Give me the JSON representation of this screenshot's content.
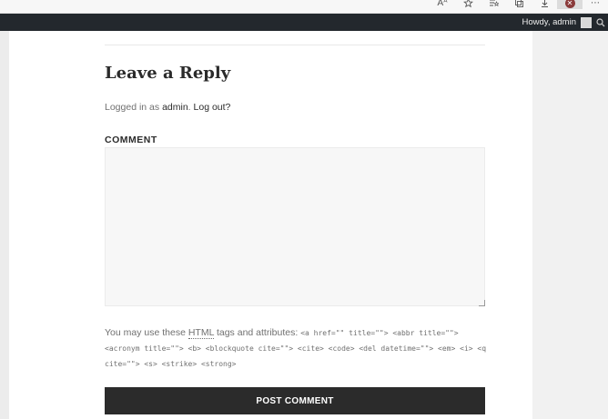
{
  "browser": {
    "icons": [
      "read-aloud-icon",
      "favorites-add-icon",
      "favorites-icon",
      "collections-icon",
      "downloads-icon",
      "profile-icon",
      "more-icon"
    ],
    "read_aloud_glyph": "Aᴬ",
    "profile_glyph": "✕",
    "more_glyph": "⋯"
  },
  "admin_bar": {
    "greeting": "Howdy, admin"
  },
  "reply": {
    "title": "Leave a Reply",
    "logged_in_prefix": "Logged in as ",
    "user_link": "admin",
    "separator": ". ",
    "logout_link": "Log out?",
    "comment_label": "COMMENT",
    "comment_value": "",
    "allowed_prefix": "You may use these ",
    "allowed_abbr": "HTML",
    "allowed_suffix": " tags and attributes: ",
    "allowed_tags": "<a href=\"\" title=\"\"> <abbr title=\"\"> <acronym title=\"\"> <b> <blockquote cite=\"\"> <cite> <code> <del datetime=\"\"> <em> <i> <q cite=\"\"> <s> <strike> <strong>",
    "post_button": "POST COMMENT"
  }
}
